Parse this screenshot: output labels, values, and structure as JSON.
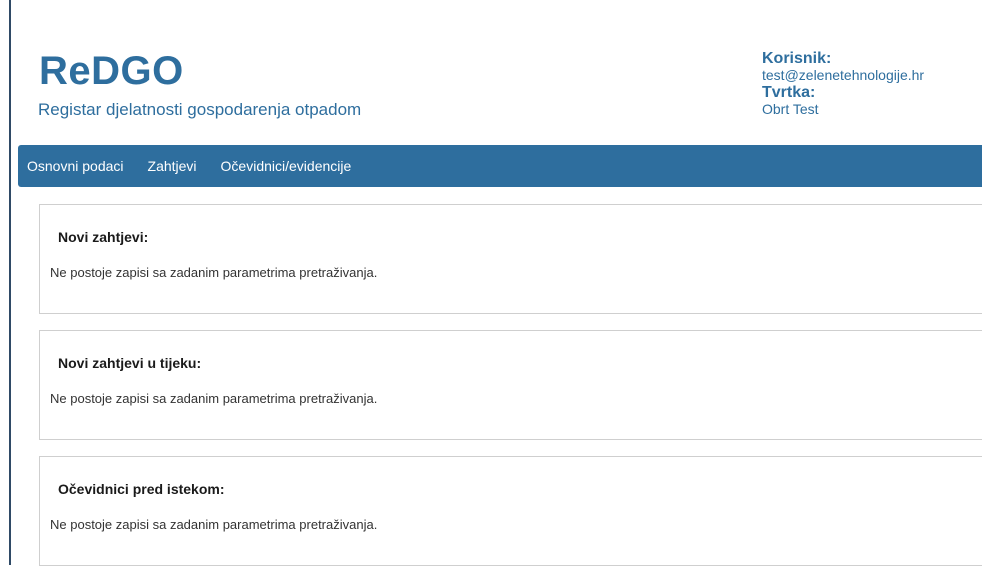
{
  "header": {
    "title": "ReDGO",
    "subtitle": "Registar djelatnosti gospodarenja otpadom"
  },
  "user": {
    "user_label": "Korisnik:",
    "user_value": "test@zelenetehnologije.hr",
    "company_label": "Tvrtka:",
    "company_value": "Obrt Test"
  },
  "nav": {
    "items": [
      {
        "label": "Osnovni podaci"
      },
      {
        "label": "Zahtjevi"
      },
      {
        "label": "Očevidnici/evidencije"
      }
    ]
  },
  "panels": [
    {
      "title": "Novi zahtjevi:",
      "message": "Ne postoje zapisi sa zadanim parametrima pretraživanja."
    },
    {
      "title": "Novi zahtjevi u tijeku:",
      "message": "Ne postoje zapisi sa zadanim parametrima pretraživanja."
    },
    {
      "title": "Očevidnici pred istekom:",
      "message": "Ne postoje zapisi sa zadanim parametrima pretraživanja."
    }
  ],
  "colors": {
    "brand": "#2e6e9e",
    "nav_background": "#2e6e9e",
    "panel_border": "#cfcfcf"
  }
}
